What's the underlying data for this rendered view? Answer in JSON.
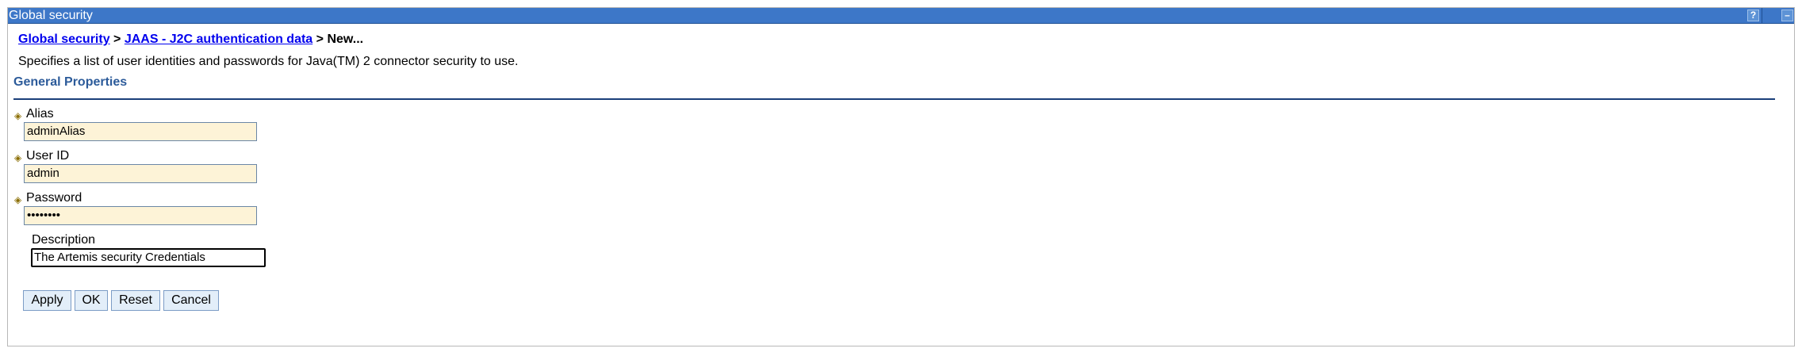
{
  "window": {
    "title": "Global security",
    "help_glyph": "?",
    "minimize_glyph": "–"
  },
  "breadcrumb": {
    "item1": "Global security",
    "sep1": " > ",
    "item2": "JAAS - J2C authentication data",
    "sep2": " > ",
    "current": "New..."
  },
  "description": "Specifies a list of user identities and passwords for Java(TM) 2 connector security to use.",
  "section_title": "General Properties",
  "required_glyph": "◈",
  "fields": {
    "alias": {
      "label": "Alias",
      "value": "adminAlias"
    },
    "user_id": {
      "label": "User ID",
      "value": "admin"
    },
    "password": {
      "label": "Password",
      "value": "••••••••"
    },
    "description": {
      "label": "Description",
      "value": "The Artemis security Credentials"
    }
  },
  "buttons": {
    "apply": "Apply",
    "ok": "OK",
    "reset": "Reset",
    "cancel": "Cancel"
  },
  "colors": {
    "titlebar": "#3d77c8",
    "field_bg": "#fdf3d7",
    "link": "#0000ee",
    "section": "#2c5b9a"
  }
}
